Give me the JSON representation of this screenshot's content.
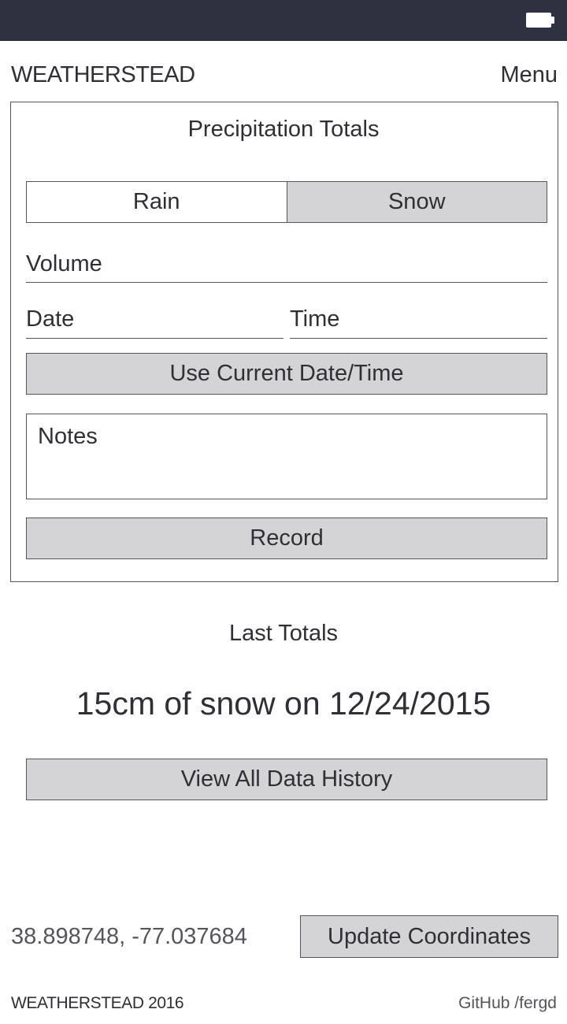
{
  "status_bar": {
    "battery_icon": "battery-icon"
  },
  "header": {
    "title": "WEATHERSTEAD",
    "menu_label": "Menu"
  },
  "form": {
    "title": "Precipitation Totals",
    "precip_type": {
      "options": [
        "Rain",
        "Snow"
      ],
      "selected": "Snow"
    },
    "volume": {
      "value": "",
      "placeholder": "Volume"
    },
    "date": {
      "value": "",
      "placeholder": "Date"
    },
    "time": {
      "value": "",
      "placeholder": "Time"
    },
    "use_current_label": "Use Current Date/Time",
    "notes": {
      "value": "",
      "placeholder": "Notes"
    },
    "record_label": "Record"
  },
  "last_totals": {
    "heading": "Last Totals",
    "summary": "15cm of snow on 12/24/2015",
    "history_label": "View All Data History"
  },
  "location": {
    "coordinates": "38.898748, -77.037684",
    "update_label": "Update Coordinates"
  },
  "footer": {
    "brand": "WEATHERSTEAD 2016",
    "github": "GitHub /fergd"
  },
  "colors": {
    "status_bar": "#2e3140",
    "button_gray": "#d4d4d6",
    "border": "#55565c",
    "text": "#2f2f35"
  }
}
